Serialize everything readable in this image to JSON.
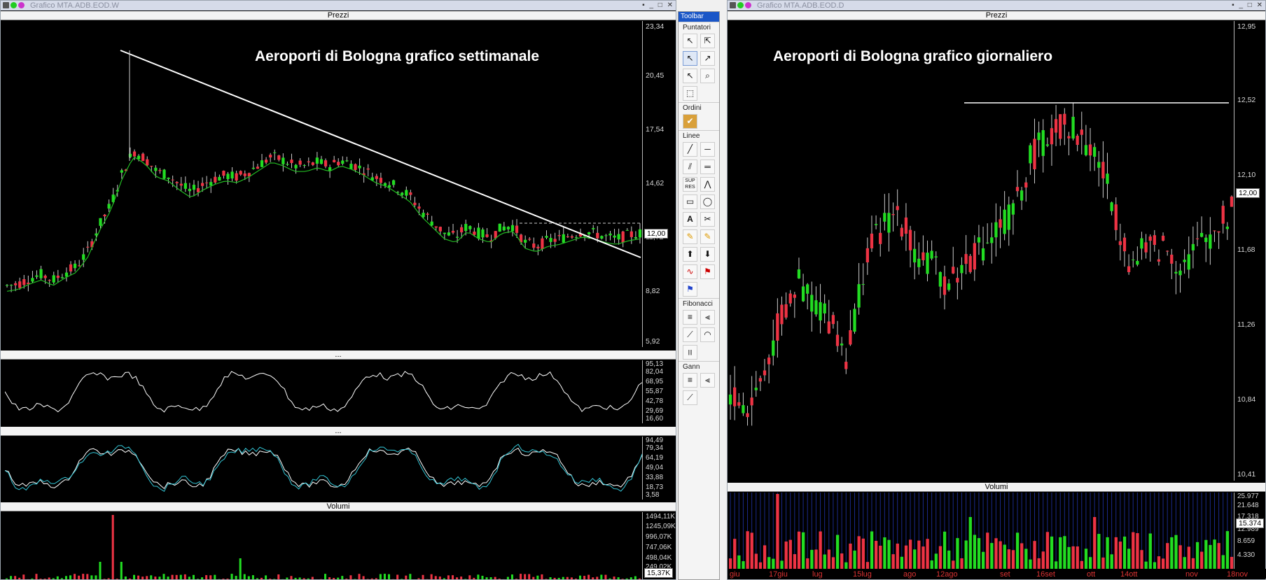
{
  "left_window": {
    "title": "Grafico MTA.ADB.EOD.W",
    "overlay": "Aeroporti di Bologna grafico settimanale",
    "price_panel": {
      "title": "Prezzi",
      "ticks": [
        "23,34",
        "20,45",
        "17,54",
        "14,62",
        "11,72",
        "8,82",
        "5,92"
      ],
      "current": "12,00"
    },
    "osc1_panel": {
      "title": "...",
      "ticks": [
        "95,13",
        "82,04",
        "68,95",
        "55,87",
        "42,78",
        "29,69",
        "16,60"
      ]
    },
    "osc2_panel": {
      "title": "...",
      "ticks": [
        "94,49",
        "79,34",
        "64,19",
        "49,04",
        "33,88",
        "18,73",
        "3,58"
      ]
    },
    "vol_panel": {
      "title": "Volumi",
      "ticks": [
        "1494,11K",
        "1245,09K",
        "996,07K",
        "747,06K",
        "498,04K",
        "249,02K"
      ],
      "current": "15,37K"
    }
  },
  "right_window": {
    "title": "Grafico MTA.ADB.EOD.D",
    "overlay": "Aeroporti di Bologna grafico giornaliero",
    "price_panel": {
      "title": "Prezzi",
      "ticks": [
        "12,95",
        "12,52",
        "12,10",
        "11,68",
        "11,26",
        "10,84",
        "10,41"
      ],
      "current": "12,00"
    },
    "vol_panel": {
      "title": "Volumi",
      "ticks": [
        "25.977",
        "21.648",
        "17.318",
        "12.989",
        "8.659",
        "4.330"
      ],
      "current": "15.374"
    },
    "dates": [
      "giu",
      "17giu",
      "lug",
      "15lug",
      "ago",
      "12ago",
      "set",
      "16set",
      "ott",
      "14ott",
      "nov",
      "18nov"
    ]
  },
  "toolbar": {
    "title": "Toolbar",
    "sections": [
      "Puntatori",
      "Ordini",
      "Linee",
      "Fibonacci",
      "Gann"
    ]
  },
  "colors": {
    "up": "#22dd22",
    "down": "#ee3344",
    "ma": "#22bb22",
    "line": "#ffffff",
    "osc": "#ffffff",
    "osc_alt": "#33c6d6"
  }
}
